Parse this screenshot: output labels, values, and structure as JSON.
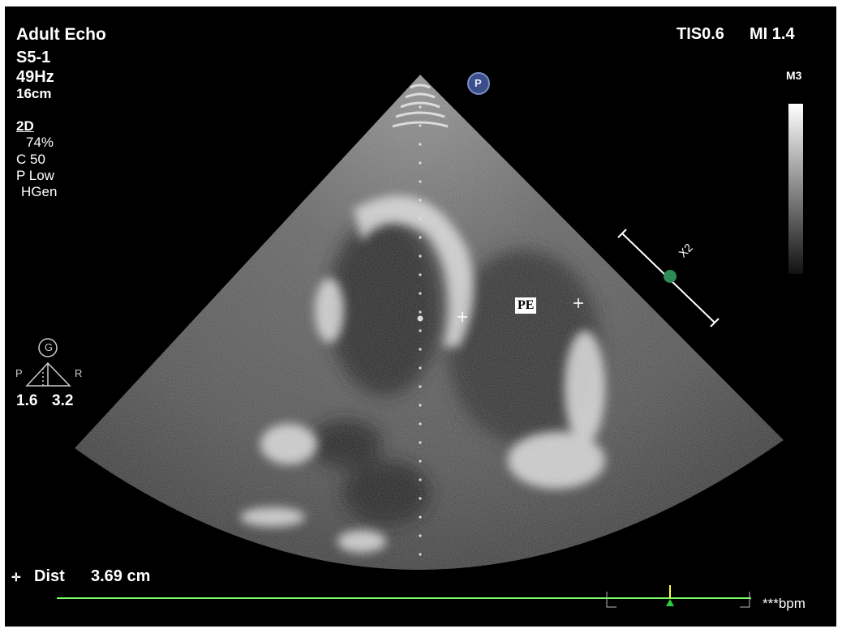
{
  "preset": "Adult Echo",
  "probe": "S5-1",
  "frame_rate": "49Hz",
  "depth": "16cm",
  "mode": "2D",
  "gain": "74%",
  "compression": "C 50",
  "power": "P Low",
  "harmonics": "HGen",
  "tis": "TIS0.6",
  "mi": "MI 1.4",
  "colormap": "M3",
  "p_marker": "P",
  "orientation": {
    "g_label": "G",
    "p_label": "P",
    "r_label": "R",
    "left_value": "1.6",
    "right_value": "3.2"
  },
  "annotation": "PE",
  "scale_bar_label": "X2",
  "measurement": {
    "symbol": "✛",
    "label": "Dist",
    "value": "3.69 cm"
  },
  "heart_rate": "***bpm",
  "colors": {
    "ecg_line": "#7CFC6A",
    "marker_green": "#2e8b57",
    "cursor_yellow": "#ffff33"
  }
}
